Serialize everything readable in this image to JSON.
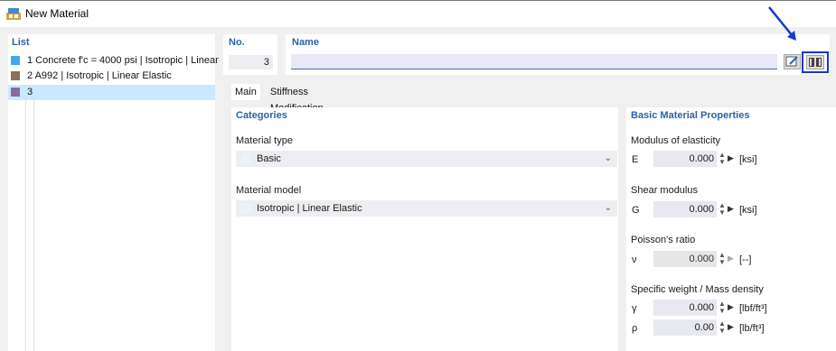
{
  "window": {
    "title": "New Material"
  },
  "list": {
    "header": "List",
    "items": [
      {
        "label": "1 Concrete f'c = 4000 psi | Isotropic | Linear",
        "color": "#3fa8f0"
      },
      {
        "label": "2 A992 | Isotropic | Linear Elastic",
        "color": "#8b7158"
      },
      {
        "label": "3",
        "color": "#8a6aa0"
      }
    ]
  },
  "no": {
    "header": "No.",
    "value": "3"
  },
  "name": {
    "header": "Name",
    "value": ""
  },
  "tabs": [
    {
      "label": "Main"
    },
    {
      "label": "Stiffness Modification"
    }
  ],
  "categories": {
    "header": "Categories",
    "material_type_label": "Material type",
    "material_type_value": "Basic",
    "material_model_label": "Material model",
    "material_model_value": "Isotropic | Linear Elastic"
  },
  "properties": {
    "header": "Basic Material Properties",
    "modulus": {
      "label": "Modulus of elasticity",
      "symbol": "E",
      "value": "0.000",
      "unit": "[ksi]"
    },
    "shear": {
      "label": "Shear modulus",
      "symbol": "G",
      "value": "0.000",
      "unit": "[ksi]"
    },
    "poisson": {
      "label": "Poisson's ratio",
      "symbol": "ν",
      "value": "0.000",
      "unit": "[--]"
    },
    "weight": {
      "label": "Specific weight / Mass density",
      "gamma": {
        "symbol": "γ",
        "value": "0.000",
        "unit": "[lbf/ft³]"
      },
      "rho": {
        "symbol": "ρ",
        "value": "0.00",
        "unit": "[lb/ft³]"
      }
    }
  },
  "icons": {
    "app": "material-app-icon",
    "edit": "edit-name-icon",
    "library": "material-library-book-icon",
    "annotation": "pointer-arrow-icon"
  },
  "colors": {
    "accent": "#2b62a8",
    "highlight_frame": "#1537d2",
    "selection": "#cce8ff"
  }
}
